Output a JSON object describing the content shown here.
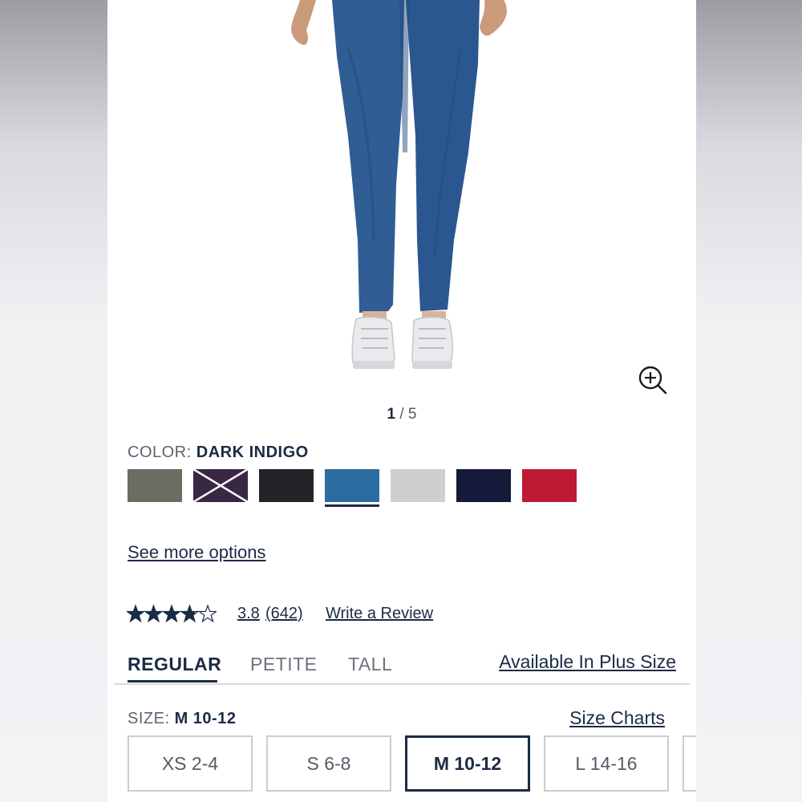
{
  "gallery": {
    "current_image": "1",
    "total_images": "5",
    "separator": "/"
  },
  "color": {
    "label": "COLOR:",
    "selected_name": "DARK INDIGO",
    "swatches": [
      {
        "hex": "#6b6c62",
        "state": "available"
      },
      {
        "hex": "#3a2744",
        "state": "unavailable"
      },
      {
        "hex": "#222429",
        "state": "available"
      },
      {
        "hex": "#2c6da1",
        "state": "selected"
      },
      {
        "hex": "#cfcfd1",
        "state": "available"
      },
      {
        "hex": "#15193a",
        "state": "available"
      },
      {
        "hex": "#bf1a33",
        "state": "available"
      }
    ]
  },
  "see_more": "See more options",
  "reviews": {
    "rating": "3.8",
    "rating_value": 3.8,
    "max_rating": 5,
    "count": "(642)",
    "write_review": "Write a Review"
  },
  "fit_tabs": [
    {
      "label": "REGULAR",
      "active": true
    },
    {
      "label": "PETITE",
      "active": false
    },
    {
      "label": "TALL",
      "active": false
    }
  ],
  "plus_size_link": "Available In Plus Size",
  "size": {
    "label": "SIZE:",
    "selected": "M 10-12",
    "charts_link": "Size Charts",
    "options": [
      "XS 2-4",
      "S 6-8",
      "M 10-12",
      "L 14-16"
    ]
  },
  "colors": {
    "accent": "#1b2b45",
    "pants": "#2f5d94"
  }
}
